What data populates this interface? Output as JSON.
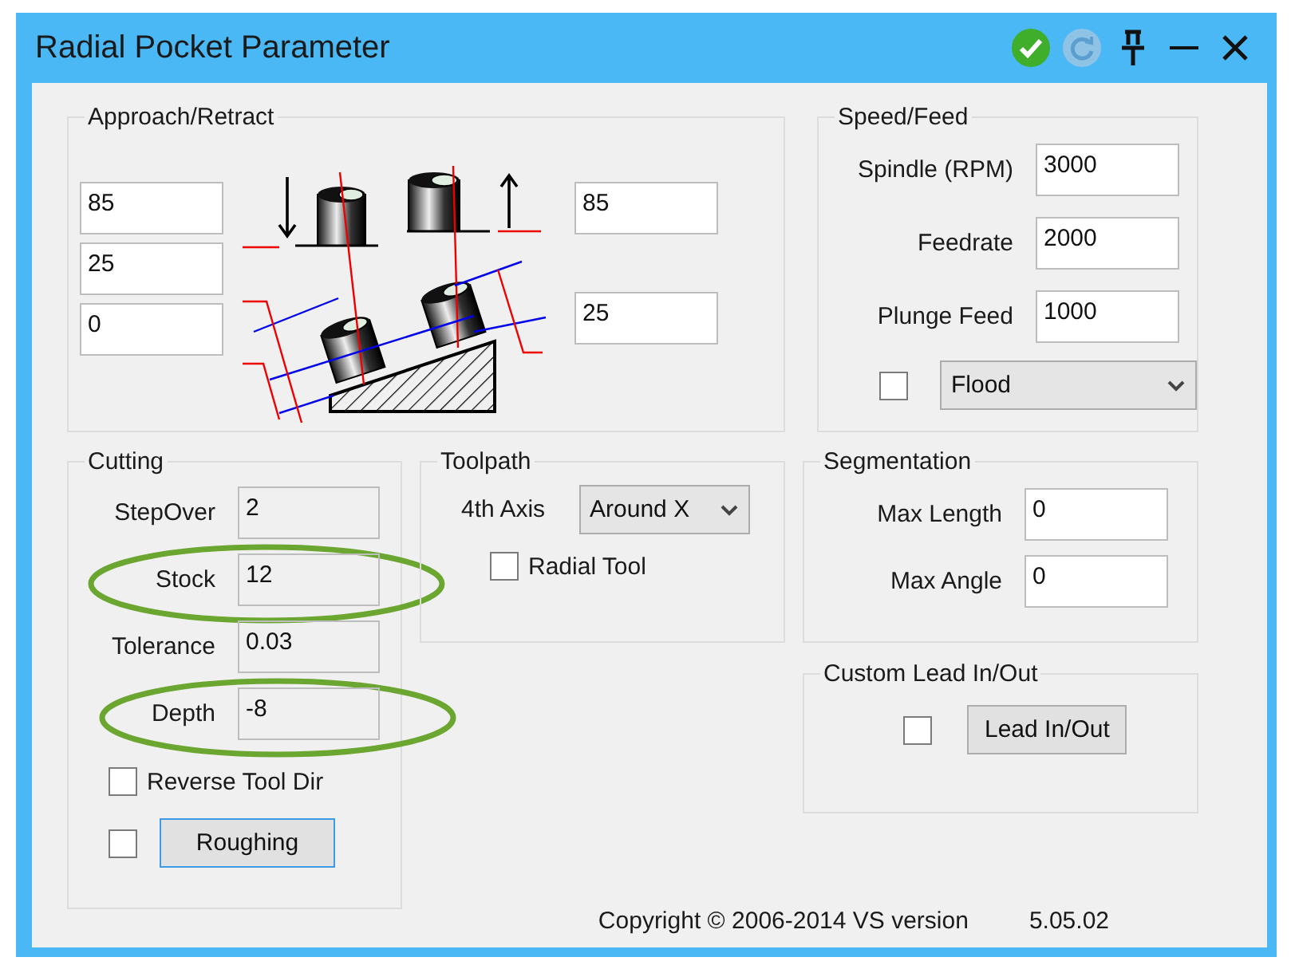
{
  "window": {
    "title": "Radial Pocket Parameter"
  },
  "approach_retract": {
    "title": "Approach/Retract",
    "left_fields": [
      {
        "value": "85"
      },
      {
        "value": "25"
      },
      {
        "value": "0"
      }
    ],
    "right_fields": [
      {
        "value": "85"
      },
      {
        "value": "25"
      }
    ]
  },
  "speed_feed": {
    "title": "Speed/Feed",
    "fields": [
      {
        "label": "Spindle (RPM)",
        "value": "3000"
      },
      {
        "label": "Feedrate",
        "value": "2000"
      },
      {
        "label": "Plunge Feed",
        "value": "1000"
      }
    ],
    "coolant": {
      "checked": false,
      "value": "Flood"
    }
  },
  "cutting": {
    "title": "Cutting",
    "fields": [
      {
        "label": "StepOver",
        "value": "2",
        "highlighted": false
      },
      {
        "label": "Stock",
        "value": "12",
        "highlighted": true
      },
      {
        "label": "Tolerance",
        "value": "0.03",
        "highlighted": false
      },
      {
        "label": "Depth",
        "value": "-8",
        "highlighted": true
      }
    ],
    "reverse_tool_dir": {
      "label": "Reverse Tool Dir",
      "checked": false
    },
    "roughing": {
      "checked": false,
      "label": "Roughing",
      "focused": true
    }
  },
  "toolpath": {
    "title": "Toolpath",
    "axis": {
      "label": "4th Axis",
      "value": "Around X"
    },
    "radial_tool": {
      "label": "Radial Tool",
      "checked": false
    }
  },
  "segmentation": {
    "title": "Segmentation",
    "fields": [
      {
        "label": "Max Length",
        "value": "0"
      },
      {
        "label": "Max Angle",
        "value": "0"
      }
    ]
  },
  "lead": {
    "title": "Custom Lead In/Out",
    "checked": false,
    "button": "Lead In/Out"
  },
  "footer": {
    "copyright": "Copyright © 2006-2014 VS version",
    "version": "5.05.02"
  }
}
